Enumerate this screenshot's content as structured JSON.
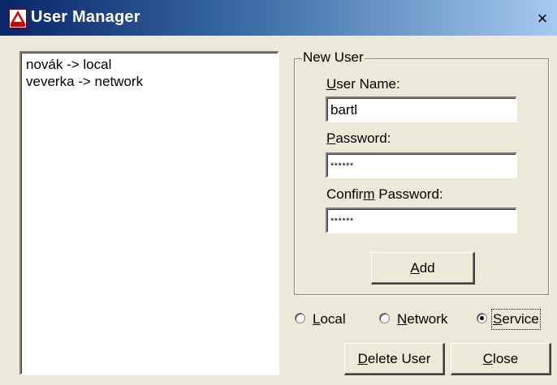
{
  "window": {
    "title": "User Manager",
    "icon": "app-logo-icon",
    "close_glyph": "×"
  },
  "user_list": {
    "items": [
      "novák -> local",
      "veverka -> network"
    ]
  },
  "new_user": {
    "group_label": "New User",
    "user_name_label": {
      "mnemonic": "U",
      "rest": "ser Name:"
    },
    "user_name_value": "bartl",
    "password_label": {
      "mnemonic": "P",
      "rest": "assword:"
    },
    "password_value": "******",
    "confirm_label": {
      "before": "Confir",
      "mnemonic": "m",
      "rest": " Password:"
    },
    "confirm_value": "******",
    "add_button": {
      "mnemonic": "A",
      "rest": "dd"
    }
  },
  "user_type": {
    "options": [
      {
        "mnemonic": "L",
        "rest": "ocal",
        "selected": false
      },
      {
        "mnemonic": "N",
        "rest": "etwork",
        "selected": false
      },
      {
        "mnemonic": "S",
        "rest": "ervice",
        "selected": true
      }
    ]
  },
  "buttons": {
    "delete_user": {
      "mnemonic": "D",
      "rest": "elete User"
    },
    "close": {
      "mnemonic": "C",
      "rest": "lose"
    }
  }
}
